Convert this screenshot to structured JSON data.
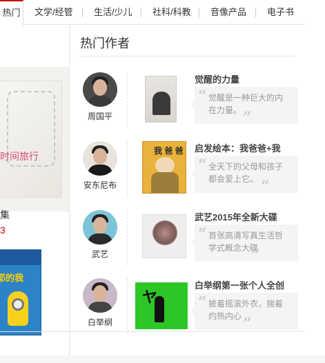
{
  "nav": {
    "active": "热门",
    "tabs": [
      "文学/经管",
      "生活/少儿",
      "社科/科教",
      "音像产品",
      "电子书"
    ]
  },
  "left": {
    "cover_title": "时间旅行",
    "caption_line1": "集",
    "caption_line2": "3",
    "dvd_text": "耶的我"
  },
  "section": {
    "title": "热门作者"
  },
  "authors": [
    {
      "name": "周国平",
      "book_title": "觉醒的力量",
      "quote": "觉醒是一种巨大的内在力量。"
    },
    {
      "name": "安东尼布",
      "book_title": "启发绘本：我爸爸+我",
      "quote": "全天下的父母和孩子都会爱上它。"
    },
    {
      "name": "武艺",
      "book_title": "武艺2015年全新大碟",
      "quote": "首张高清写真生活哲学式概念大碟"
    },
    {
      "name": "白举纲",
      "book_title": "白举纲第一张个人全创",
      "quote": "披着摇滚外衣，揣着灼热内心"
    }
  ],
  "colors": {
    "accent": "#c9000d"
  }
}
